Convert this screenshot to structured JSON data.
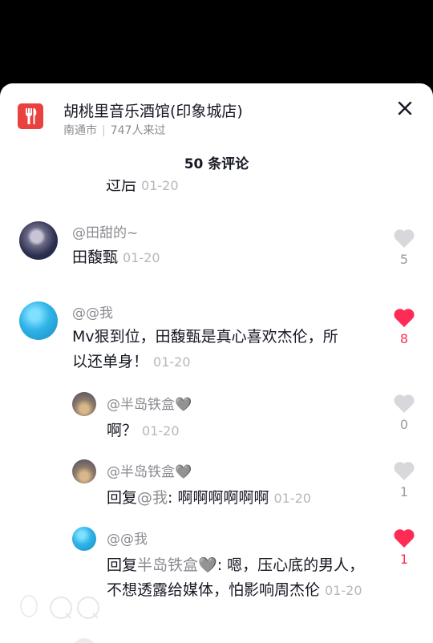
{
  "place": {
    "icon": "restaurant-fork-icon",
    "title": "胡桃里音乐酒馆(印象城店)",
    "city": "南通市",
    "separator": "|",
    "visitors": "747人来过",
    "accent": "#e8413f"
  },
  "comments_title": "50 条评论",
  "clipped_prev": {
    "text": "过后",
    "time": "01-20"
  },
  "comments": [
    {
      "user": "@田甜的~",
      "text": "田馥甄",
      "time": "01-20",
      "likes": "5",
      "liked": false
    },
    {
      "user": "@@我",
      "text": "Mv狠到位，田馥甄是真心喜欢杰伦，所以还单身！",
      "time": "01-20",
      "likes": "8",
      "liked": true,
      "replies": [
        {
          "user": "@半岛铁盒🩶",
          "text": "啊？",
          "time": "01-20",
          "likes": "0",
          "liked": false
        },
        {
          "user": "@半岛铁盒🩶",
          "reply_prefix": "回复",
          "reply_to": "@我",
          "text": ": 啊啊啊啊啊啊",
          "time": "01-20",
          "likes": "1",
          "liked": false
        },
        {
          "user": "@@我",
          "reply_prefix": "回复",
          "reply_to": "半岛铁盒🩶",
          "text": ": 嗯，压心底的男人，不想透露给媒体，怕影响周杰伦",
          "time": "01-20",
          "likes": "1",
          "liked": true
        }
      ]
    }
  ],
  "colors": {
    "like_active": "#fe2c55",
    "like_inactive": "#d8d8dc"
  }
}
